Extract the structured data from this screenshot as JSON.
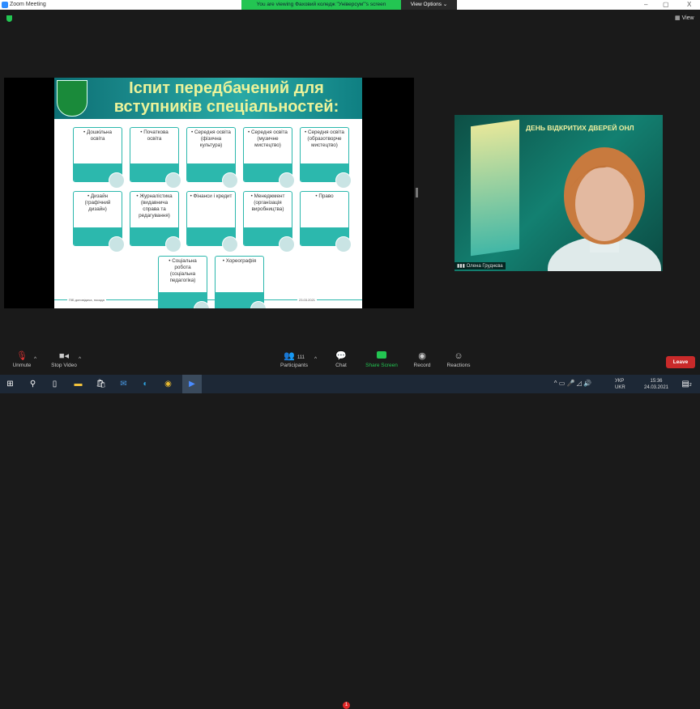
{
  "titlebar": {
    "title": "Zoom Meeting",
    "banner": "You are viewing Фаховий коледж \"Універсум\"'s screen",
    "view_options": "View Options ⌄",
    "minimize": "–",
    "maximize": "▢",
    "close": "X",
    "view": "View"
  },
  "slide": {
    "title": "Іспит передбачений для вступників спеціальностей:",
    "row1": [
      "• Дошкільна освіта",
      "• Початкова освіта",
      "• Середня освіта (фізична культура)",
      "• Середня освіта (музичне мистецтво)",
      "• Середня освіта (образотворче мистецтво)"
    ],
    "row2": [
      "• Дизайн (графічний дизайн)",
      "• Журналістика (видавнича справа та редагування)",
      "• Фінанси і кредит",
      "• Менеджмент (організація виробництва)",
      "• Право"
    ],
    "row3": [
      "• Соціальна робота (соціальна педагогіка)",
      "• Хореографія"
    ],
    "footer_left": "ПІБ доповідача, посада",
    "footer_right": "23.03.2021"
  },
  "video": {
    "banner": "ДЕНЬ ВІДКРИТИХ ДВЕРЕЙ ОНЛ",
    "name": "Олена Груднєва"
  },
  "toolbar": {
    "unmute": "Unmute",
    "stop_video": "Stop Video",
    "participants": "Participants",
    "participants_count": "111",
    "chat": "Chat",
    "chat_badge": "1",
    "share": "Share Screen",
    "record": "Record",
    "reactions": "Reactions",
    "leave": "Leave"
  },
  "taskbar": {
    "lang1": "УКР",
    "lang2": "UKR",
    "time": "15:36",
    "date": "24.03.2021",
    "notifications": "2"
  },
  "colors": {
    "teal": "#2cb8ad",
    "share_green": "#23c552",
    "leave_red": "#c92a2a"
  }
}
